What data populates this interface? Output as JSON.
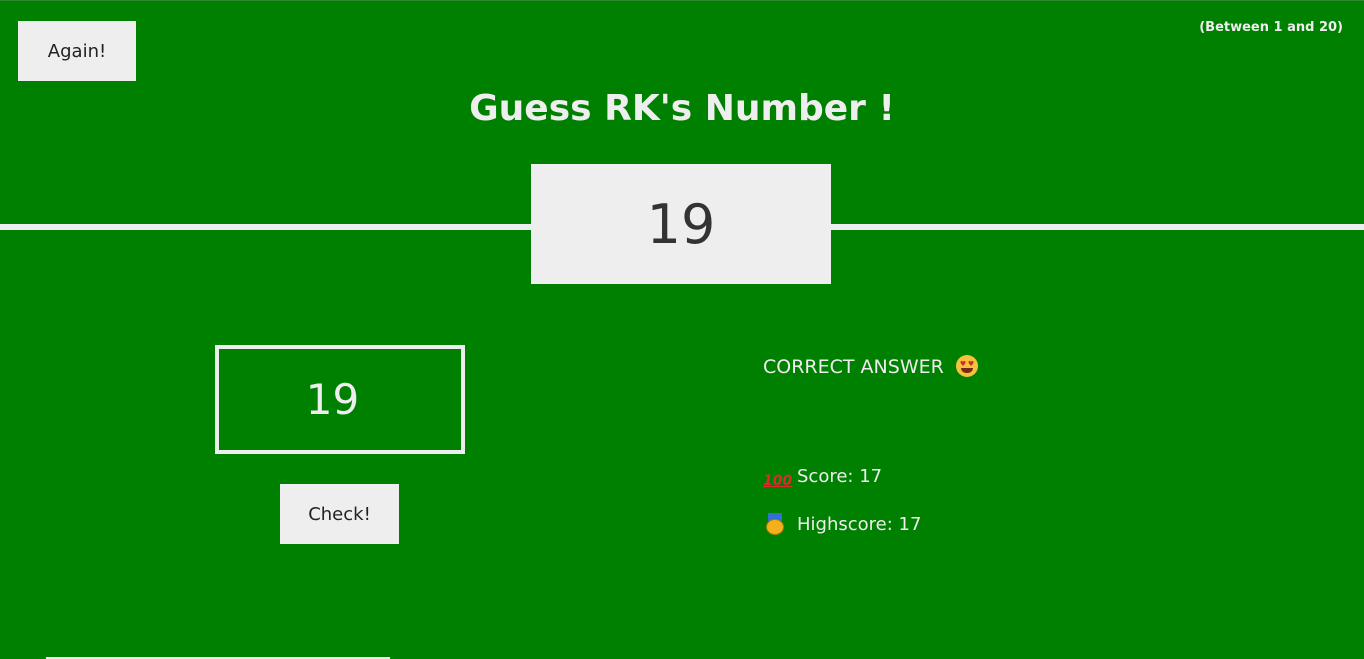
{
  "header": {
    "again_label": "Again!",
    "range_hint": "(Between 1 and 20)",
    "title": "Guess RK's Number !"
  },
  "secret": {
    "number": "19"
  },
  "guess": {
    "value": "19"
  },
  "controls": {
    "check_label": "Check!"
  },
  "result": {
    "message": "CORRECT ANSWER",
    "message_icon": "heart-eyes-emoji-icon"
  },
  "stats": {
    "score_label": "Score: ",
    "score_value": "17",
    "score_icon": "hundred-points-icon",
    "highscore_label": "Highscore: ",
    "highscore_value": "17",
    "highscore_icon": "medal-icon"
  },
  "theme": {
    "background": "#008000",
    "foreground": "#eeeeee",
    "box_text": "#333333"
  }
}
